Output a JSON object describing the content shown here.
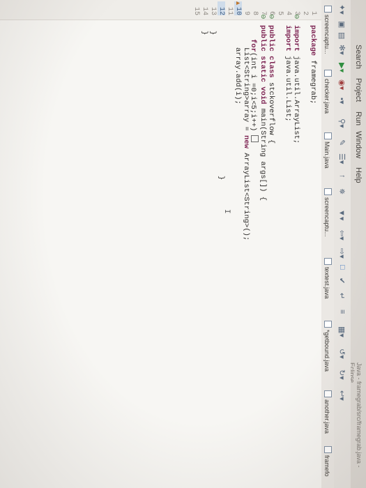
{
  "menu": [
    {
      "label": "Search"
    },
    {
      "label": "Project"
    },
    {
      "label": "Run"
    },
    {
      "label": "Window"
    },
    {
      "label": "Help"
    }
  ],
  "perspective": "Java - framegrab/src/framegrab.java - Eclipse",
  "tabs": [
    {
      "label": "screencaptu..."
    },
    {
      "label": "checker.java"
    },
    {
      "label": "Main.java"
    },
    {
      "label": "screencaptu..."
    },
    {
      "label": "textest.java"
    },
    {
      "label": "*getbound.java"
    },
    {
      "label": "another.java"
    },
    {
      "label": "framefo"
    }
  ],
  "lines": [
    {
      "n": "1",
      "kw": "package",
      "text": " framegrab;"
    },
    {
      "n": "2",
      "kw": "",
      "text": ""
    },
    {
      "n": "3",
      "kw": "import",
      "text": " java.util.ArrayList;"
    },
    {
      "n": "4",
      "kw": "import",
      "text": " java.util.List;"
    },
    {
      "n": "5",
      "kw": "",
      "text": ""
    },
    {
      "n": "6",
      "kw": "public class",
      "text": " stckoverflow {"
    },
    {
      "n": "7",
      "kw": "public static void",
      "text": " main(String args[]) {"
    },
    {
      "n": "8",
      "kw": "for",
      "text": "(int i =0;i<5;i++)"
    },
    {
      "n": "9",
      "kw": "",
      "text": "List<String>array = "
    },
    {
      "n": "10",
      "kw": "",
      "text": "array.add(i);"
    },
    {
      "n": "11",
      "kw": "",
      "text": ""
    },
    {
      "n": "12",
      "kw": "",
      "text": "}"
    },
    {
      "n": "13",
      "kw": "",
      "text": "}"
    },
    {
      "n": "14",
      "kw": "",
      "text": "}"
    },
    {
      "n": "15",
      "kw": "",
      "text": ""
    }
  ],
  "line9_new": "new",
  "line9_rest": " ArrayList<String>();",
  "cursor_glyph": "I"
}
